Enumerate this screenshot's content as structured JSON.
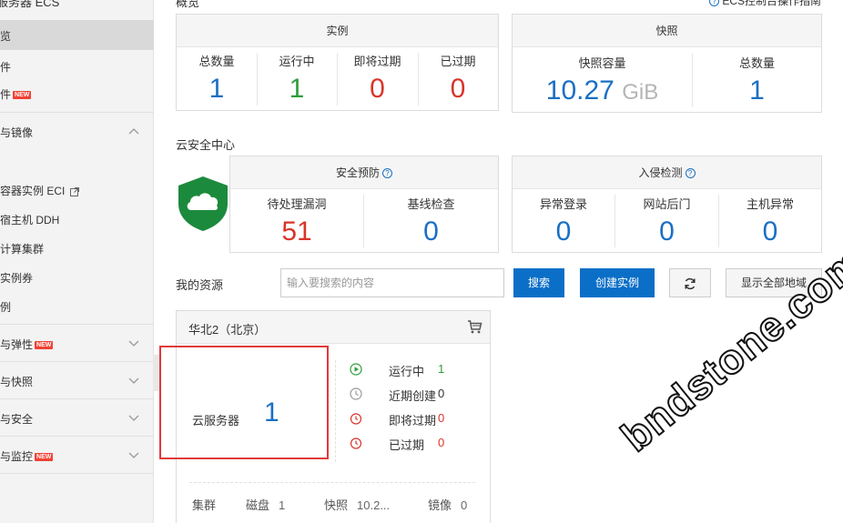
{
  "sidebar": {
    "title": "服务器 ECS",
    "items": [
      {
        "label": "览"
      },
      {
        "label": "件"
      },
      {
        "label": "件",
        "badge": "NEW"
      },
      {
        "label": "与镜像"
      },
      {
        "label": ""
      },
      {
        "label": "容器实例 ECI"
      },
      {
        "label": "宿主机 DDH"
      },
      {
        "label": "计算集群"
      },
      {
        "label": "实例券"
      },
      {
        "label": "例"
      },
      {
        "label": "与弹性",
        "badge": "NEW"
      },
      {
        "label": "与快照"
      },
      {
        "label": "与安全"
      },
      {
        "label": "与监控",
        "badge": "NEW"
      }
    ]
  },
  "overview": {
    "title": "概览",
    "guide_link": "ECS控制台操作指南",
    "instances": {
      "header": "实例",
      "stats": [
        {
          "label": "总数量",
          "value": "1"
        },
        {
          "label": "运行中",
          "value": "1"
        },
        {
          "label": "即将过期",
          "value": "0"
        },
        {
          "label": "已过期",
          "value": "0"
        }
      ]
    },
    "snapshots": {
      "header": "快照",
      "capacity_label": "快照容量",
      "capacity_value": "10.27",
      "capacity_unit": "GiB",
      "count_label": "总数量",
      "count_value": "1"
    }
  },
  "security": {
    "title": "云安全中心",
    "prevention": {
      "header": "安全预防",
      "help": "?",
      "stats": [
        {
          "label": "待处理漏洞",
          "value": "51"
        },
        {
          "label": "基线检查",
          "value": "0"
        }
      ]
    },
    "intrusion": {
      "header": "入侵检测",
      "help": "?",
      "stats": [
        {
          "label": "异常登录",
          "value": "0"
        },
        {
          "label": "网站后门",
          "value": "0"
        },
        {
          "label": "主机异常",
          "value": "0"
        }
      ]
    }
  },
  "resources": {
    "title": "我的资源",
    "search_placeholder": "输入要搜索的内容",
    "search_button": "搜索",
    "create_button": "创建实例",
    "show_all_button": "显示全部地域",
    "region": {
      "name": "华北2（北京）",
      "server_label": "云服务器",
      "server_count": "1",
      "statuses": [
        {
          "label": "运行中",
          "value": "1"
        },
        {
          "label": "近期创建",
          "value": "0"
        },
        {
          "label": "即将过期",
          "value": "0"
        },
        {
          "label": "已过期",
          "value": "0"
        }
      ],
      "bottom": [
        {
          "label": "集群",
          "value": ""
        },
        {
          "label": "磁盘",
          "value": "1"
        },
        {
          "label": "快照",
          "value": "10.2..."
        },
        {
          "label": "镜像",
          "value": "0"
        }
      ]
    }
  },
  "watermark": "bndstone.com",
  "colors": {
    "accent": "#0b6fc7",
    "green": "#2e9e3a",
    "red": "#d9352b",
    "highlight_box": "#e03a3a"
  }
}
